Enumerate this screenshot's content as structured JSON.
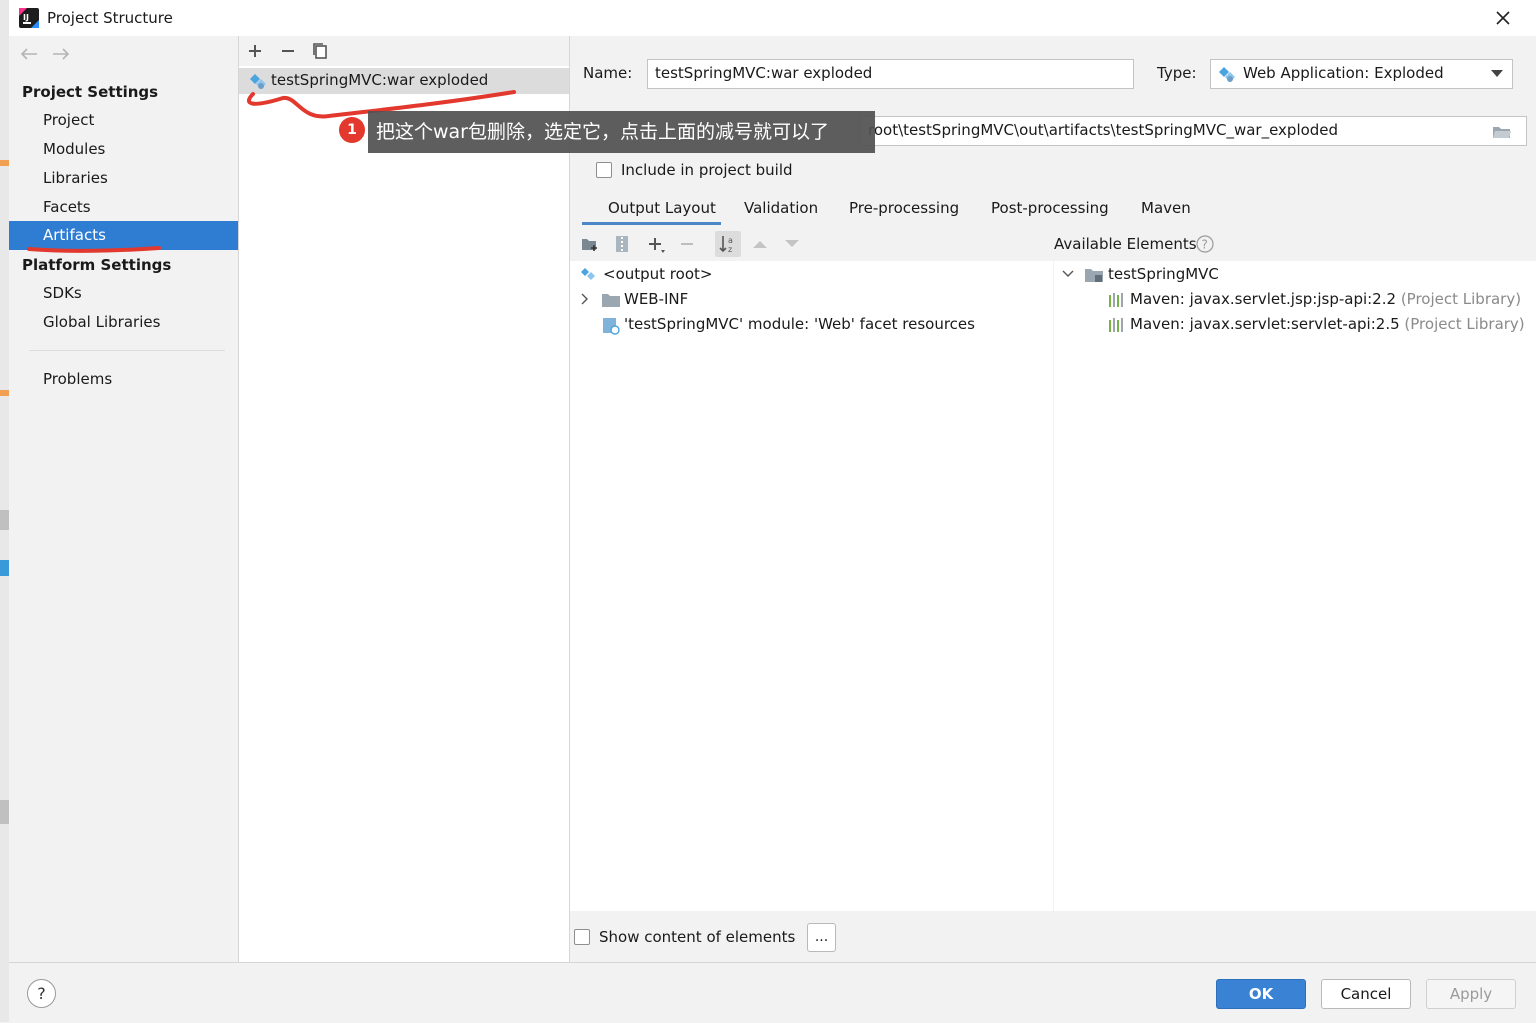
{
  "window": {
    "title": "Project Structure"
  },
  "nav": {
    "project_settings_header": "Project Settings",
    "project_items": [
      "Project",
      "Modules",
      "Libraries",
      "Facets",
      "Artifacts"
    ],
    "platform_settings_header": "Platform Settings",
    "platform_items": [
      "SDKs",
      "Global Libraries"
    ],
    "problems": "Problems",
    "selected": "Artifacts"
  },
  "artifacts_list": {
    "items": [
      "testSpringMVC:war exploded"
    ]
  },
  "details": {
    "name_label": "Name:",
    "name_value": "testSpringMVC:war exploded",
    "type_label": "Type:",
    "type_value": "Web Application: Exploded",
    "output_dir_value": "root\\testSpringMVC\\out\\artifacts\\testSpringMVC_war_exploded",
    "include_label": "Include in project build",
    "tabs": [
      "Output Layout",
      "Validation",
      "Pre-processing",
      "Post-processing",
      "Maven"
    ],
    "active_tab": "Output Layout",
    "available_elements_label": "Available Elements",
    "output_tree": [
      "<output root>",
      "WEB-INF",
      "'testSpringMVC' module: 'Web' facet resources"
    ],
    "available_tree": {
      "root": "testSpringMVC",
      "libs": [
        {
          "name": "Maven: javax.servlet.jsp:jsp-api:2.2",
          "scope": "(Project Library)"
        },
        {
          "name": "Maven: javax.servlet:servlet-api:2.5",
          "scope": "(Project Library)"
        }
      ]
    },
    "show_content_label": "Show content of elements",
    "ellipsis_label": "..."
  },
  "footer": {
    "ok": "OK",
    "cancel": "Cancel",
    "apply": "Apply",
    "help": "?"
  },
  "callout": {
    "badge": "1",
    "text": "把这个war包删除，选定它，点击上面的减号就可以了"
  },
  "colors": {
    "selection": "#2f7dd3",
    "annotation_red": "#e2382d",
    "ok_button": "#3a82d4"
  }
}
